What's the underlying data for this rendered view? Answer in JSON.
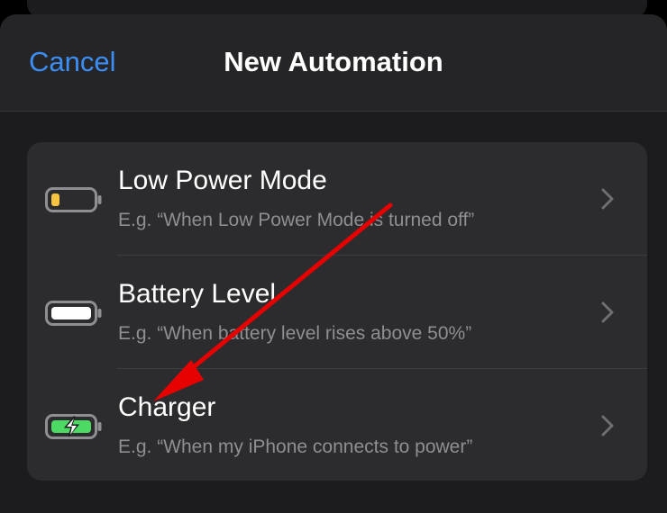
{
  "nav": {
    "cancel_label": "Cancel",
    "title": "New Automation"
  },
  "rows": [
    {
      "title": "Low Power Mode",
      "subtitle": "E.g. “When Low Power Mode is turned off”",
      "icon": "battery-low-icon"
    },
    {
      "title": "Battery Level",
      "subtitle": "E.g. “When battery level rises above 50%”",
      "icon": "battery-full-icon"
    },
    {
      "title": "Charger",
      "subtitle": "E.g. “When my iPhone connects to power”",
      "icon": "battery-charging-icon"
    }
  ],
  "colors": {
    "accent": "#3c8ef7",
    "low_battery": "#f6c343",
    "charging": "#4cd964",
    "annotation_arrow": "#e60000"
  }
}
